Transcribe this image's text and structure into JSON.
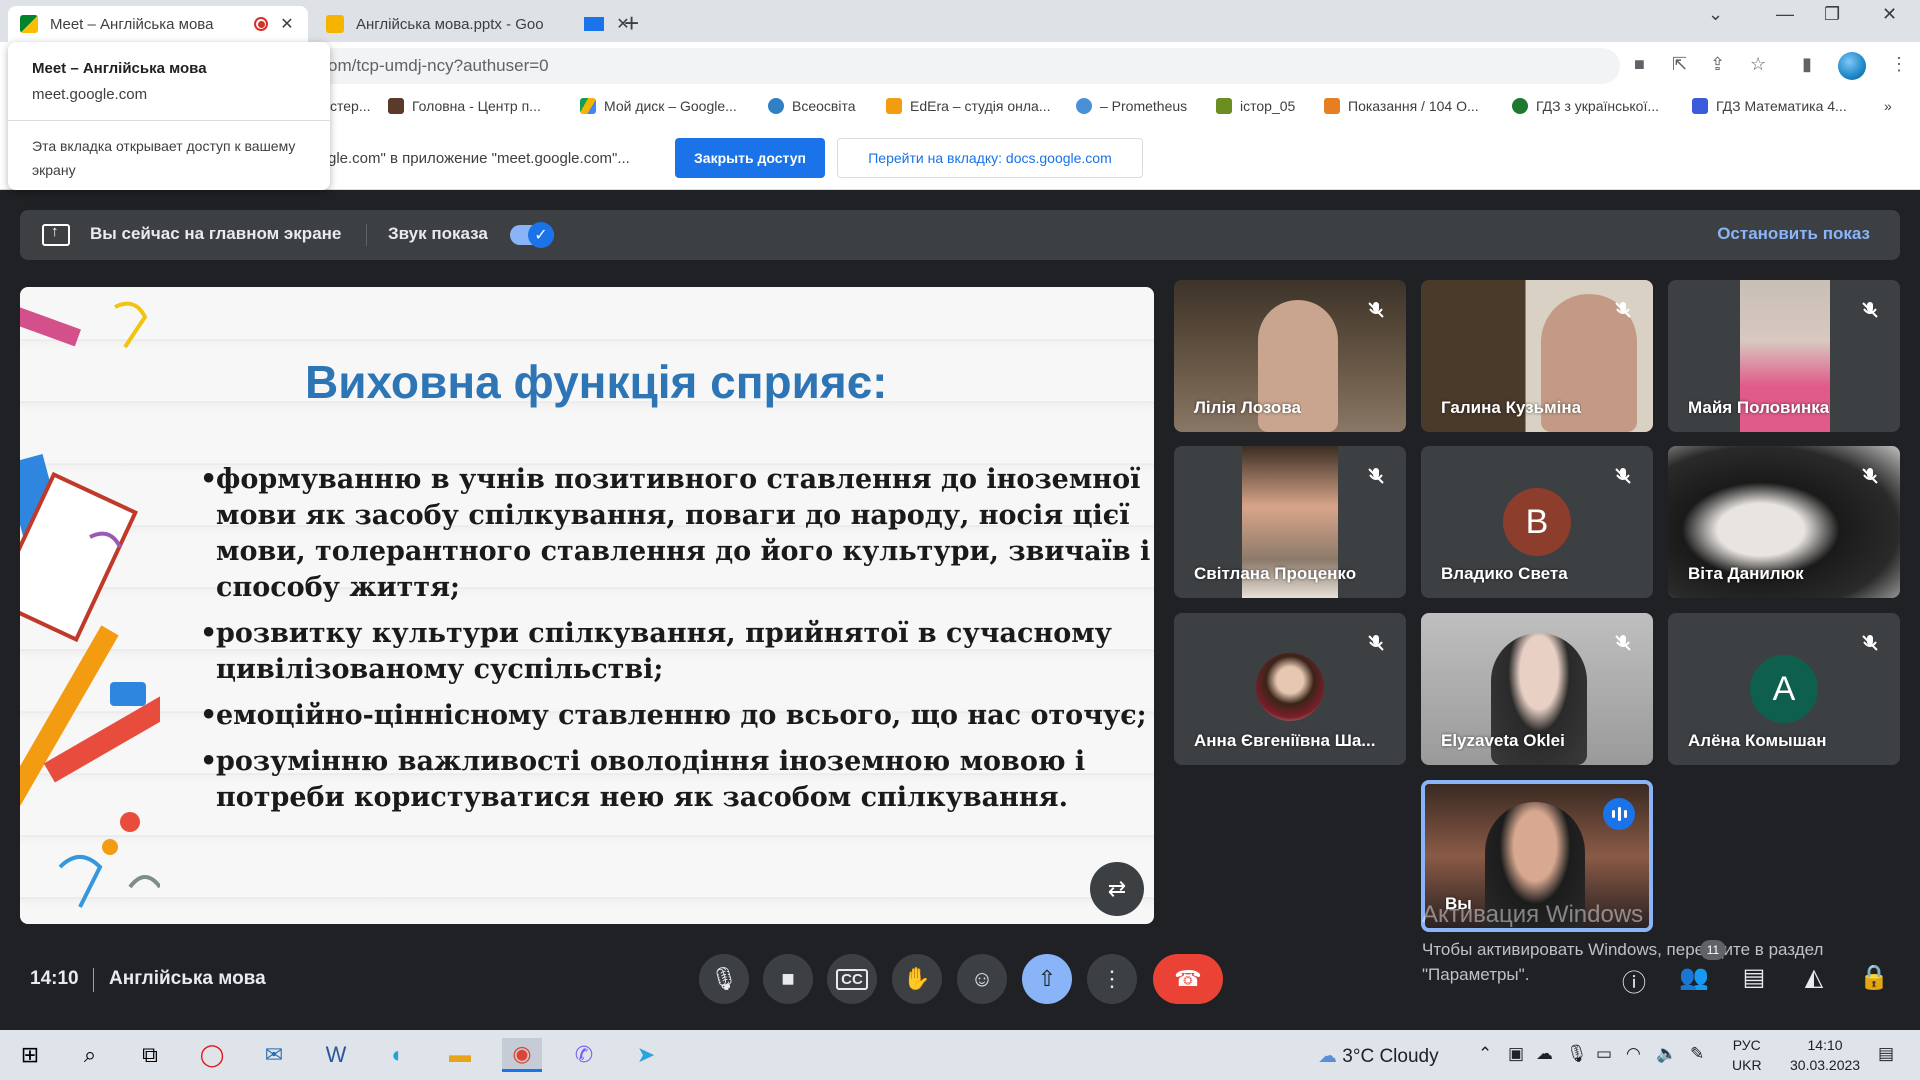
{
  "browser": {
    "tabs": [
      {
        "title": "Meet – Англійська мова",
        "active": true
      },
      {
        "title": "Англійська мова.pptx - Goo",
        "active": false
      }
    ],
    "url": "om/tcp-umdj-ncy?authuser=0",
    "bookmarks": [
      "стер...",
      "Головна - Центр п...",
      "Мой диск – Google...",
      "Всеосвіта",
      "EdEra – студія онла...",
      "– Prometheus",
      "істор_05",
      "Показання / 104 О...",
      "ГДЗ з української...",
      "ГДЗ Математика 4..."
    ],
    "bookmarks_more": "»",
    "infobar": {
      "text": "gle.com\" в приложение \"meet.google.com\"...",
      "stop_access": "Закрыть доступ",
      "switch_tab": "Перейти на вкладку: docs.google.com"
    },
    "hovercard": {
      "title": "Meet – Англійська мова",
      "domain": "meet.google.com",
      "note": "Эта вкладка открывает доступ к вашему экрану"
    }
  },
  "meet": {
    "presenting_bar": {
      "text": "Вы сейчас на главном экране",
      "sound_label": "Звук показа",
      "stop_label": "Остановить показ"
    },
    "slide": {
      "title": "Виховна функція сприяє:",
      "bullets": [
        "формуванню в учнів позитивного ставлення до іноземної мови як засобу спілкування, поваги до народу, носія цієї мови, толерантного ставлення до його культури, звичаїв і способу життя;",
        "розвитку культури спілкування, прийнятої в сучасному цивілізованому суспільстві;",
        "емоційно-ціннісному ставленню до всього, що нас оточує;",
        "розумінню важливості оволодіння іноземною мовою і потреби користуватися нею як засобом спілкування."
      ]
    },
    "participants": [
      {
        "name": "Лілія Лозова",
        "muted": true
      },
      {
        "name": "Галина Кузьміна",
        "muted": true
      },
      {
        "name": "Майя Половинка",
        "muted": true
      },
      {
        "name": "Світлана Проценко",
        "muted": true
      },
      {
        "name": "Владико Света",
        "muted": true,
        "initial": "В",
        "avatar_color": "#8d3d2c"
      },
      {
        "name": "Віта Данилюк",
        "muted": true
      },
      {
        "name": "Анна Євгеніївна Ша...",
        "muted": true
      },
      {
        "name": "Elyzaveta Oklei",
        "muted": true
      },
      {
        "name": "Алёна Комышан",
        "muted": true,
        "initial": "А",
        "avatar_color": "#0f5f4f"
      },
      {
        "name": "Вы",
        "muted": false,
        "speaking": true
      }
    ],
    "watermark": {
      "title": "Активация Windows",
      "text": "Чтобы активировать Windows, перейдите в раздел \"Параметры\"."
    },
    "bottom_bar": {
      "time": "14:10",
      "meeting_title": "Англійська мова",
      "participant_count": "11"
    }
  },
  "taskbar": {
    "weather": "3°C  Cloudy",
    "lang_top": "РУС",
    "lang_bottom": "UKR",
    "time": "14:10",
    "date": "30.03.2023"
  }
}
